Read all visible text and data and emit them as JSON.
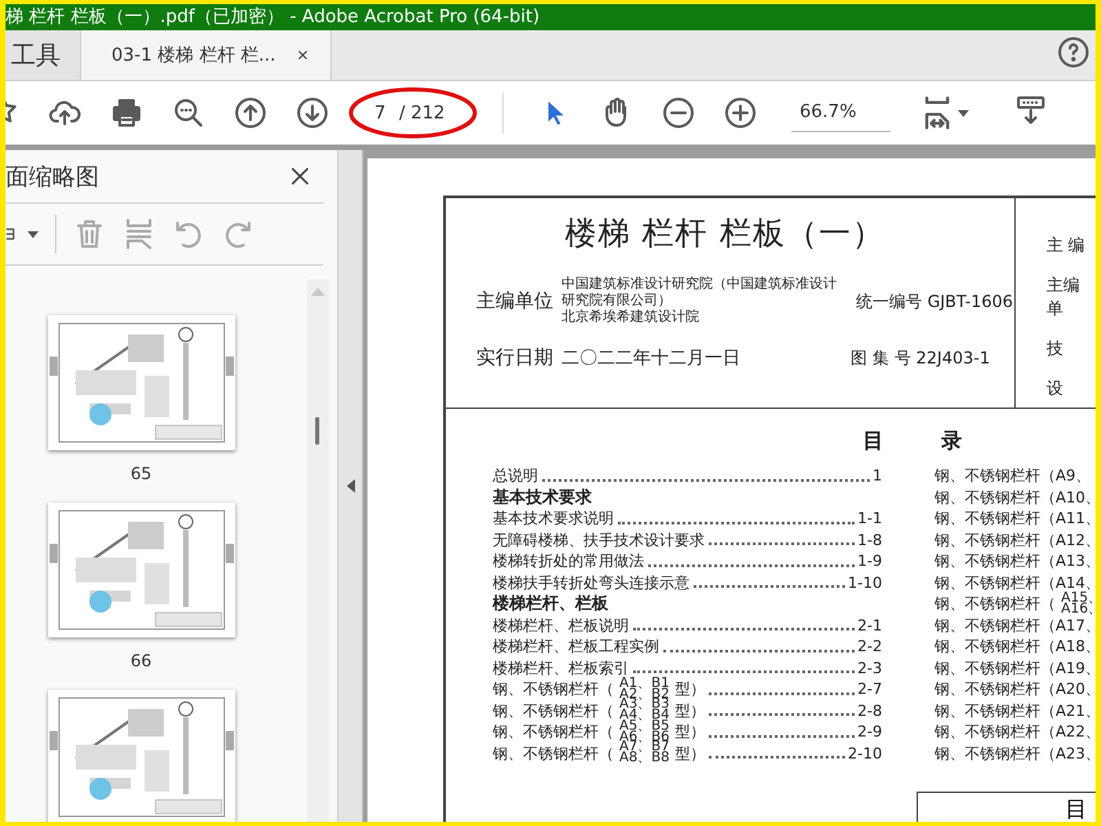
{
  "window": {
    "title": "梯 栏杆 栏板（一）.pdf（已加密） - Adobe Acrobat Pro (64-bit)"
  },
  "tabs": [
    {
      "label": "工具",
      "selected": false
    },
    {
      "label": "03-1 楼梯 栏杆 栏...",
      "selected": true
    }
  ],
  "toolbar": {
    "page_number": "7",
    "page_total": "/ 212",
    "zoom": "66.7%",
    "select_tool": {
      "selected": true
    },
    "hand_tool": {
      "selected": false
    }
  },
  "sidebar": {
    "title": "面缩略图",
    "thumbnails": [
      {
        "kind": "picture",
        "label": "65"
      },
      {
        "kind": "picture",
        "label": "66"
      },
      {
        "kind": "picture"
      }
    ]
  },
  "document": {
    "title": "楼梯 栏杆 栏板（一）",
    "org_label": "主编单位",
    "org_lines": [
      "中国建筑标准设计研究院（中国建筑标准设计研究院有限公司）",
      "北京希埃希建筑设计院"
    ],
    "code": "统一编号 GJBT-1606",
    "date_label": "实行日期",
    "date": "二〇二二年十二月一日",
    "atlas": "图 集 号 22J403-1",
    "side_labels": [
      "主 编",
      "主编单",
      "技",
      "设"
    ],
    "toc_heading": [
      "目",
      "录"
    ],
    "toc_left": [
      {
        "kind": "entry",
        "label": "总说明",
        "page": "1"
      },
      {
        "kind": "heading",
        "label": "基本技术要求"
      },
      {
        "kind": "entry",
        "label": "基本技术要求说明",
        "page": "1-1"
      },
      {
        "kind": "entry",
        "label": "无障碍楼梯、扶手技术设计要求",
        "page": "1-8"
      },
      {
        "kind": "entry",
        "label": "楼梯转折处的常用做法",
        "page": "1-9"
      },
      {
        "kind": "entry",
        "label": "楼梯扶手转折处弯头连接示意",
        "page": "1-10"
      },
      {
        "kind": "heading",
        "label": "楼梯栏杆、栏板"
      },
      {
        "kind": "entry",
        "label": "楼梯栏杆、栏板说明",
        "page": "2-1"
      },
      {
        "kind": "entry",
        "label": "楼梯栏杆、栏板工程实例",
        "page": "2-2"
      },
      {
        "kind": "entry",
        "label": "楼梯栏杆、栏板索引",
        "page": "2-3"
      },
      {
        "kind": "entry",
        "label": "钢、不锈钢栏杆（",
        "sub": [
          "A1、B1",
          "A2、B2"
        ],
        "after": "型）",
        "page": "2-7"
      },
      {
        "kind": "entry",
        "label": "钢、不锈钢栏杆（",
        "sub": [
          "A3、B3",
          "A4、B4"
        ],
        "after": "型）",
        "page": "2-8"
      },
      {
        "kind": "entry",
        "label": "钢、不锈钢栏杆（",
        "sub": [
          "A5、B5",
          "A6、B6"
        ],
        "after": "型）",
        "page": "2-9"
      },
      {
        "kind": "entry",
        "label": "钢、不锈钢栏杆（",
        "sub": [
          "A7、B7",
          "A8、B8"
        ],
        "after": "型）",
        "page": "2-10"
      }
    ],
    "toc_right": [
      {
        "label": "钢、不锈钢栏杆（A9、"
      },
      {
        "label": "钢、不锈钢栏杆（A10、"
      },
      {
        "label": "钢、不锈钢栏杆（A11、"
      },
      {
        "label": "钢、不锈钢栏杆（A12、"
      },
      {
        "label": "钢、不锈钢栏杆（A13、"
      },
      {
        "label": "钢、不锈钢栏杆（A14、"
      },
      {
        "label": "钢、不锈钢栏杆（",
        "sub": [
          "A15、",
          "A16、"
        ]
      },
      {
        "label": "钢、不锈钢栏杆（A17、"
      },
      {
        "label": "钢、不锈钢栏杆（A18、"
      },
      {
        "label": "钢、不锈钢栏杆（A19、"
      },
      {
        "label": "钢、不锈钢栏杆（A20、"
      },
      {
        "label": "钢、不锈钢栏杆（A21、"
      },
      {
        "label": "钢、不锈钢栏杆（A22、"
      },
      {
        "label": "钢、不锈钢栏杆（A23、"
      }
    ],
    "footer_box": "目"
  }
}
